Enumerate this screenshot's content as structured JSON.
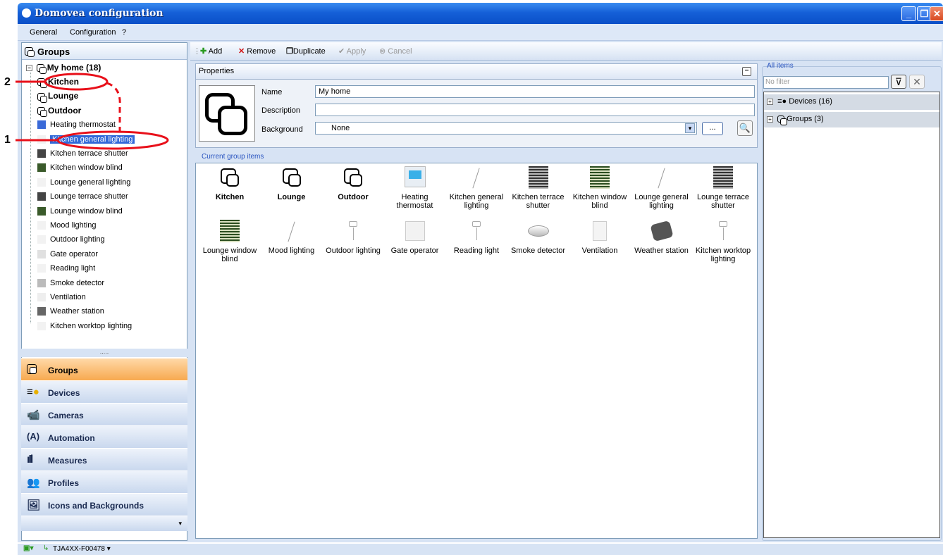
{
  "window": {
    "title": "Domovea configuration"
  },
  "menu": [
    "General",
    "Configuration",
    "?"
  ],
  "groups_panel": {
    "title": "Groups",
    "root": "My home (18)",
    "tree": [
      {
        "label": "Kitchen",
        "type": "group"
      },
      {
        "label": "Lounge",
        "type": "group"
      },
      {
        "label": "Outdoor",
        "type": "group"
      },
      {
        "label": "Heating thermostat",
        "type": "device"
      },
      {
        "label": "Kitchen general lighting",
        "type": "device",
        "selected": true
      },
      {
        "label": "Kitchen terrace shutter",
        "type": "device"
      },
      {
        "label": "Kitchen window blind",
        "type": "device"
      },
      {
        "label": "Lounge general lighting",
        "type": "device"
      },
      {
        "label": "Lounge terrace shutter",
        "type": "device"
      },
      {
        "label": "Lounge window blind",
        "type": "device"
      },
      {
        "label": "Mood lighting",
        "type": "device"
      },
      {
        "label": "Outdoor lighting",
        "type": "device"
      },
      {
        "label": "Gate operator",
        "type": "device"
      },
      {
        "label": "Reading light",
        "type": "device"
      },
      {
        "label": "Smoke detector",
        "type": "device"
      },
      {
        "label": "Ventilation",
        "type": "device"
      },
      {
        "label": "Weather station",
        "type": "device"
      },
      {
        "label": "Kitchen worktop lighting",
        "type": "device"
      }
    ]
  },
  "nav": [
    "Groups",
    "Devices",
    "Cameras",
    "Automation",
    "Measures",
    "Profiles",
    "Icons and Backgrounds"
  ],
  "toolbar": {
    "add": "Add",
    "remove": "Remove",
    "duplicate": "Duplicate",
    "apply": "Apply",
    "cancel": "Cancel"
  },
  "properties": {
    "title": "Properties",
    "name_label": "Name",
    "name_value": "My home",
    "description_label": "Description",
    "description_value": "",
    "background_label": "Background",
    "background_value": "None",
    "browse": "..."
  },
  "current_items": {
    "title": "Current group items",
    "items": [
      {
        "label": "Kitchen",
        "icon": "group-icon"
      },
      {
        "label": "Lounge",
        "icon": "group-icon"
      },
      {
        "label": "Outdoor",
        "icon": "group-icon"
      },
      {
        "label": "Heating thermostat",
        "icon": "thermostat-icon"
      },
      {
        "label": "Kitchen general lighting",
        "icon": "floor-lamp-icon"
      },
      {
        "label": "Kitchen terrace shutter",
        "icon": "shutter-icon"
      },
      {
        "label": "Kitchen window blind",
        "icon": "blind-icon"
      },
      {
        "label": "Lounge general lighting",
        "icon": "floor-lamp-icon"
      },
      {
        "label": "Lounge terrace shutter",
        "icon": "shutter-icon"
      },
      {
        "label": "Lounge window blind",
        "icon": "blind-icon"
      },
      {
        "label": "Mood lighting",
        "icon": "floor-lamp-icon"
      },
      {
        "label": "Outdoor lighting",
        "icon": "table-lamp-icon"
      },
      {
        "label": "Gate operator",
        "icon": "gate-icon"
      },
      {
        "label": "Reading light",
        "icon": "table-lamp-icon"
      },
      {
        "label": "Smoke detector",
        "icon": "smoke-detector-icon"
      },
      {
        "label": "Ventilation",
        "icon": "ventilation-icon"
      },
      {
        "label": "Weather station",
        "icon": "weather-station-icon"
      },
      {
        "label": "Kitchen worktop lighting",
        "icon": "table-lamp-icon"
      }
    ]
  },
  "all_items": {
    "title": "All items",
    "filter_placeholder": "No filter",
    "rows": [
      "Devices (16)",
      "Groups (3)"
    ]
  },
  "status": {
    "connection": "TJA4XX-F00478"
  },
  "annotations": {
    "one": "1",
    "two": "2"
  },
  "colors": {
    "accent": "#3168d8",
    "title_bar": "#0a4fc8",
    "annotation": "#e8101a",
    "nav_active": "#f7a94f"
  }
}
